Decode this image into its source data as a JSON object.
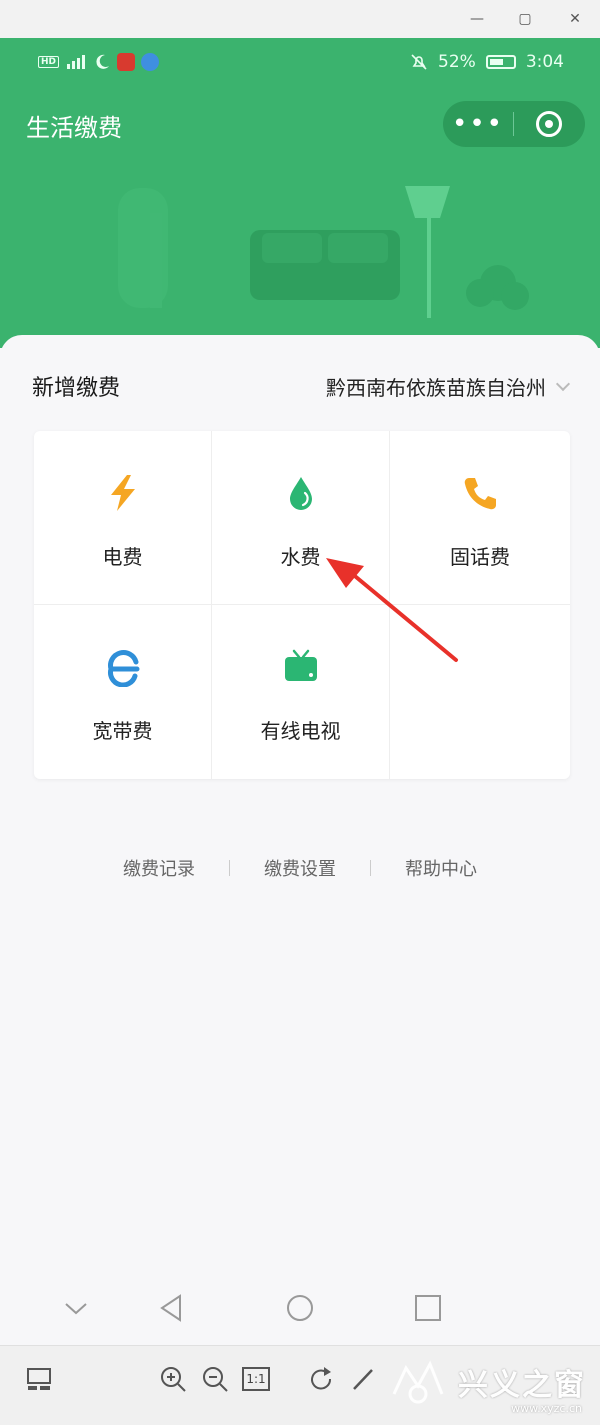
{
  "window": {
    "minimize_label": "—",
    "maximize_label": "▢",
    "close_label": "✕"
  },
  "status_bar": {
    "hd_label": "HD",
    "battery_percent": "52%",
    "time": "3:04",
    "icons": [
      "signal-icon",
      "moon-icon",
      "app-icon",
      "browser-icon",
      "mute-bell-icon",
      "battery-icon"
    ]
  },
  "header": {
    "title": "生活缴费",
    "more_label": "•••",
    "accent_color": "#3bb36e"
  },
  "main": {
    "section_title": "新增缴费",
    "region": "黔西南布依族苗族自治州",
    "services": [
      {
        "label": "电费",
        "icon": "lightning-icon",
        "color": "#f5a623"
      },
      {
        "label": "水费",
        "icon": "water-drop-icon",
        "color": "#2bb673"
      },
      {
        "label": "固话费",
        "icon": "phone-icon",
        "color": "#f5a623"
      },
      {
        "label": "宽带费",
        "icon": "broadband-e-icon",
        "color": "#2f8fd8"
      },
      {
        "label": "有线电视",
        "icon": "tv-icon",
        "color": "#2bb673"
      }
    ],
    "links": [
      "缴费记录",
      "缴费设置",
      "帮助中心"
    ]
  },
  "watermark": {
    "text": "兴义之窗",
    "url": "www.xyzc.cn"
  },
  "toolbar": {
    "actual_size_label": "1:1"
  }
}
